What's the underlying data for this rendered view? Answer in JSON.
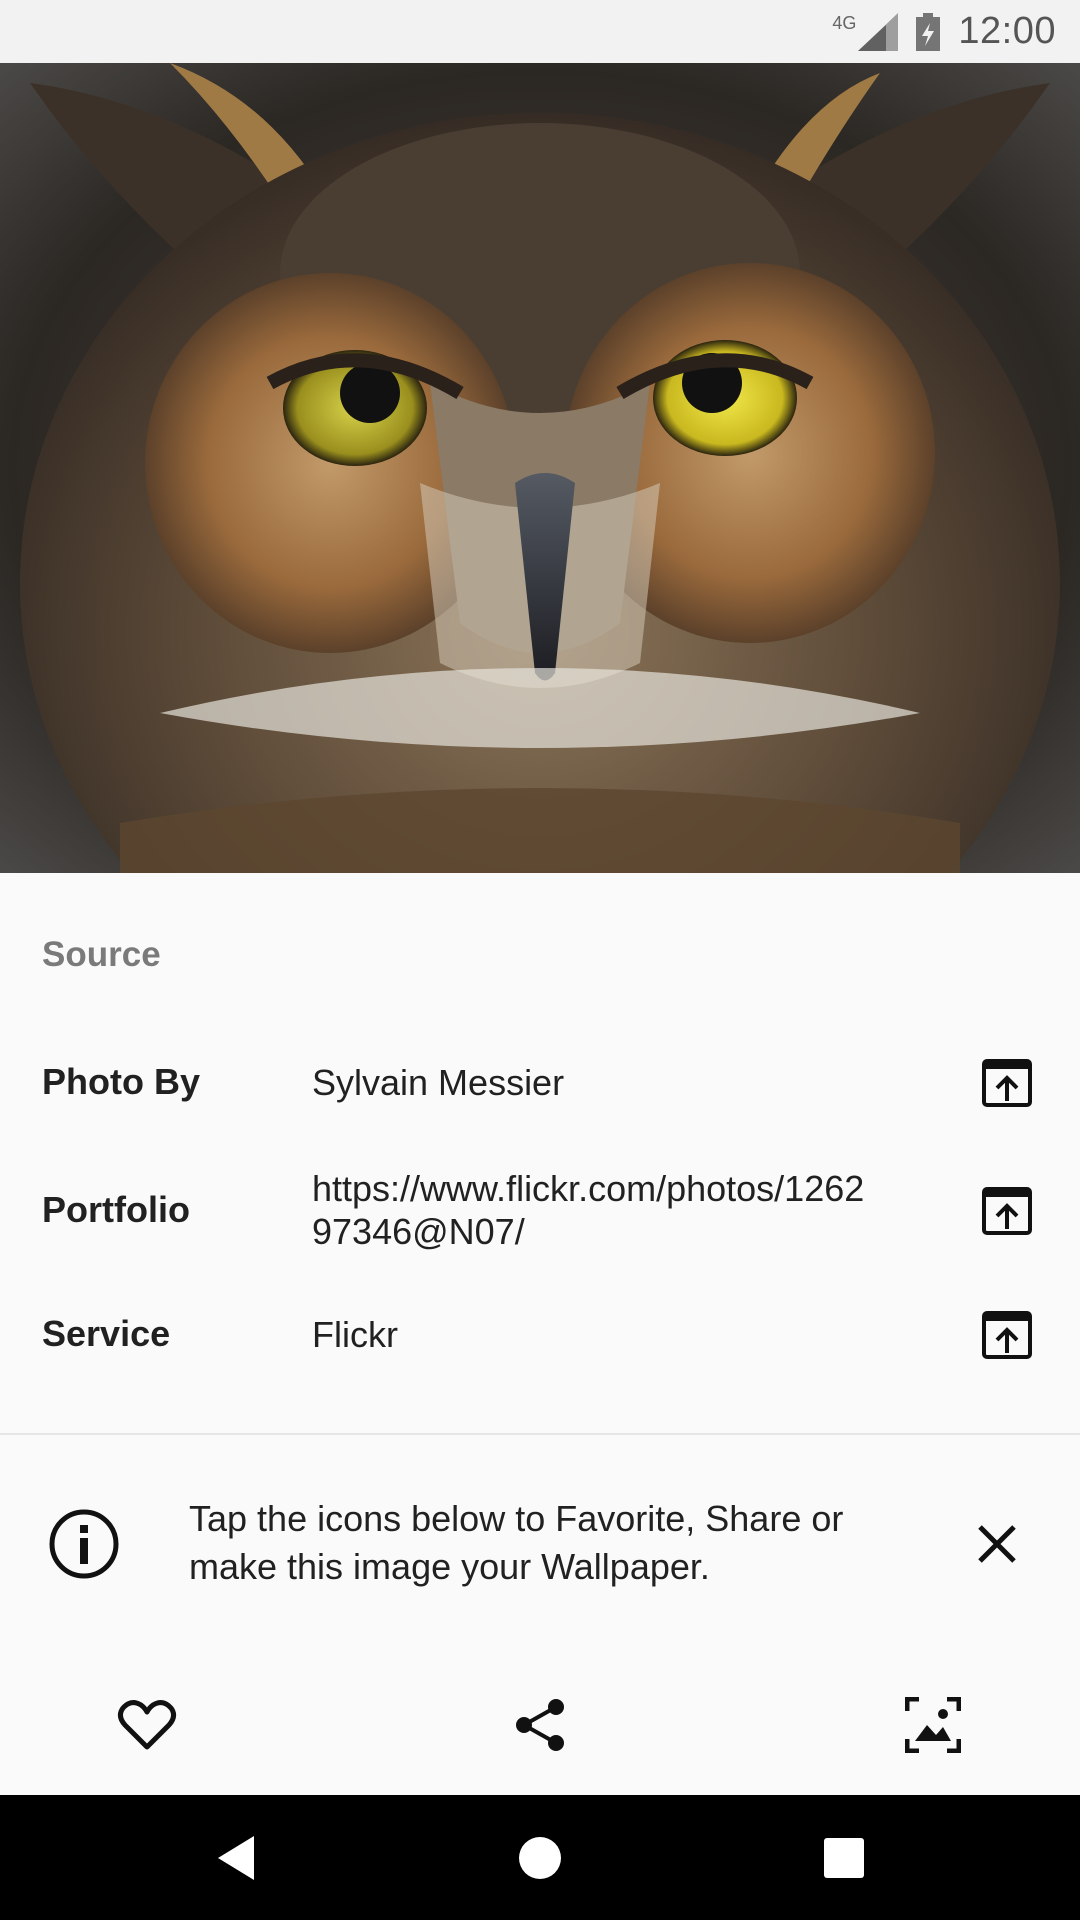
{
  "status_bar": {
    "network": "4G",
    "time": "12:00",
    "icons": [
      "signal-icon",
      "battery-icon"
    ]
  },
  "photo": {
    "subject": "owl"
  },
  "source": {
    "title": "Source",
    "rows": [
      {
        "label": "Photo By",
        "value": "Sylvain Messier",
        "icon": "open-in-new-icon"
      },
      {
        "label": "Portfolio",
        "value": "https://www.flickr.com/photos/126297346@N07/",
        "icon": "open-in-new-icon"
      },
      {
        "label": "Service",
        "value": "Flickr",
        "icon": "open-in-new-icon"
      }
    ]
  },
  "tip": {
    "text": "Tap the icons below to Favorite, Share or make this image your Wallpaper.",
    "icon": "info-icon",
    "close_icon": "close-icon"
  },
  "actions": {
    "items": [
      "favorite-icon",
      "share-icon",
      "set-wallpaper-icon"
    ]
  },
  "nav_bar": {
    "items": [
      "back-icon",
      "home-icon",
      "recents-icon"
    ]
  },
  "colors": {
    "background": "#fafafa",
    "status_bar": "#f2f2f2",
    "section_title": "#7a7a7a",
    "text": "#212121",
    "nav_bar": "#000000"
  }
}
